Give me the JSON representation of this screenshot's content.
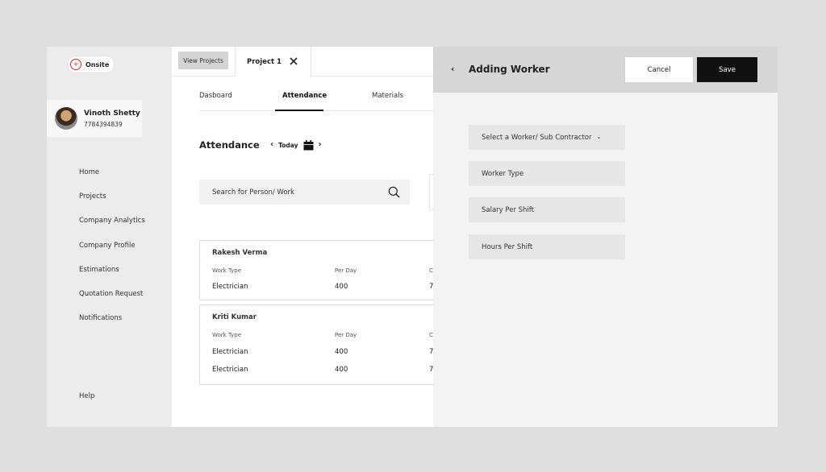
{
  "brand": {
    "name": "Onsite",
    "accent": "#c0392b"
  },
  "user": {
    "name": "Vinoth Shetty",
    "phone": "7784394839"
  },
  "sidebar": {
    "items": [
      {
        "label": "Home"
      },
      {
        "label": "Projects"
      },
      {
        "label": "Company Analytics"
      },
      {
        "label": "Company Profile"
      },
      {
        "label": "Estimations"
      },
      {
        "label": "Quotation Request"
      },
      {
        "label": "Notifications"
      }
    ],
    "help": "Help"
  },
  "tabs": {
    "view_projects": "View Projects",
    "project": "Project 1",
    "close_icon": "close-icon"
  },
  "subtabs": [
    {
      "label": "Dasboard",
      "active": false
    },
    {
      "label": "Attendance",
      "active": true
    },
    {
      "label": "Materials",
      "active": false
    }
  ],
  "attendance": {
    "title": "Attendance",
    "date_label": "Today",
    "prev_icon": "chevron-left-icon",
    "next_icon": "chevron-right-icon",
    "calendar_icon": "calendar-icon"
  },
  "search": {
    "placeholder": "Search for Person/ Work",
    "icon": "search-icon"
  },
  "cards": [
    {
      "name": "Rakesh Verma",
      "headers": [
        "Work Type",
        "Per Day",
        "C"
      ],
      "rows": [
        [
          "Electrician",
          "400",
          "7"
        ]
      ]
    },
    {
      "name": "Kriti Kumar",
      "headers": [
        "Work Type",
        "Per Day",
        "C"
      ],
      "rows": [
        [
          "Electrician",
          "400",
          "7"
        ],
        [
          "Electrician",
          "400",
          "7"
        ]
      ]
    }
  ],
  "panel": {
    "title": "Adding Worker",
    "back_icon": "chevron-left-icon",
    "cancel": "Cancel",
    "save": "Save",
    "fields": [
      {
        "label": "Select a Worker/ Sub Contractor",
        "dropdown": true
      },
      {
        "label": "Worker Type",
        "dropdown": false
      },
      {
        "label": "Salary Per Shift",
        "dropdown": false
      },
      {
        "label": "Hours Per Shift",
        "dropdown": false
      }
    ]
  }
}
